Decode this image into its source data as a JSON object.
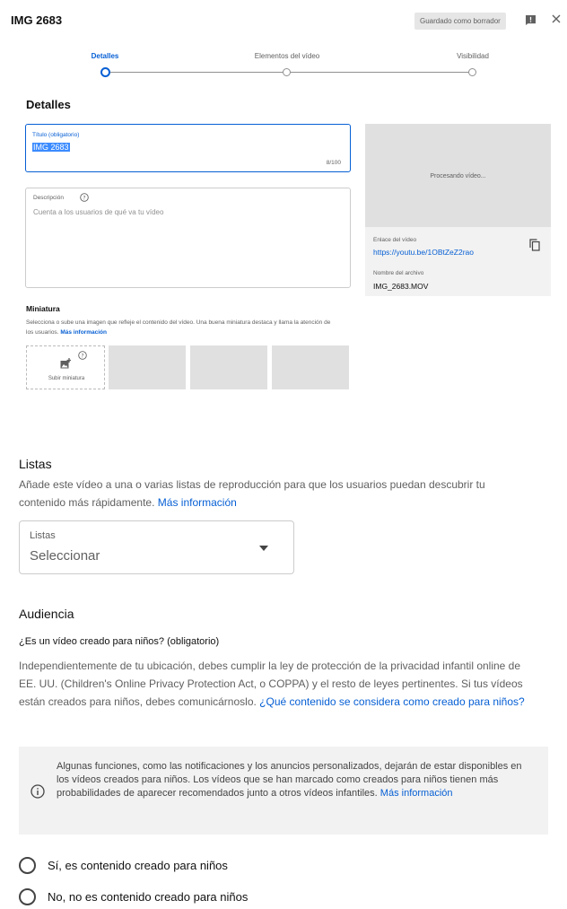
{
  "header": {
    "title": "IMG 2683",
    "draft_status": "Guardado como borrador"
  },
  "steps": [
    {
      "label": "Detalles",
      "active": true
    },
    {
      "label": "Elementos del vídeo",
      "active": false
    },
    {
      "label": "Visibilidad",
      "active": false
    }
  ],
  "details": {
    "heading": "Detalles",
    "title_label": "Título (obligatorio)",
    "title_value": "IMG 2683",
    "title_counter": "8/100",
    "description_label": "Descripción",
    "description_placeholder": "Cuenta a los usuarios de qué va tu vídeo"
  },
  "preview": {
    "processing": "Procesando vídeo...",
    "link_label": "Enlace del vídeo",
    "link_value": "https://youtu.be/1OBtZeZ2rao",
    "file_label": "Nombre del archivo",
    "file_value": "IMG_2683.MOV"
  },
  "thumbnail": {
    "heading": "Miniatura",
    "description": "Selecciona o sube una imagen que refleje el contenido del vídeo. Una buena miniatura destaca y llama la atención de los usuarios.",
    "more_info": "Más información",
    "upload_label": "Subir miniatura"
  },
  "playlists": {
    "heading": "Listas",
    "description": "Añade este vídeo a una o varias listas de reproducción para que los usuarios puedan descubrir tu contenido más rápidamente.",
    "more_info": "Más información",
    "select_label": "Listas",
    "select_value": "Seleccionar"
  },
  "audience": {
    "heading": "Audiencia",
    "question": "¿Es un vídeo creado para niños? (obligatorio)",
    "description": "Independientemente de tu ubicación, debes cumplir la ley de protección de la privacidad infantil online de EE. UU. (Children's Online Privacy Protection Act, o COPPA) y el resto de leyes pertinentes. Si tus vídeos están creados para niños, debes comunicárnoslo.",
    "link": "¿Qué contenido se considera como creado para niños?",
    "info": "Algunas funciones, como las notificaciones y los anuncios personalizados, dejarán de estar disponibles en los vídeos creados para niños. Los vídeos que se han marcado como creados para niños tienen más probabilidades de aparecer recomendados junto a otros vídeos infantiles.",
    "info_link": "Más información",
    "option_yes": "Sí, es contenido creado para niños",
    "option_no": "No, no es contenido creado para niños"
  },
  "colors": {
    "accent": "#065fd4",
    "secondary_text": "#606060",
    "panel": "#f2f2f2"
  },
  "icons": [
    "feedback-icon",
    "close-icon",
    "help-icon",
    "copy-icon",
    "add-photo-icon",
    "chevron-down-icon",
    "info-icon",
    "radio-icon"
  ]
}
